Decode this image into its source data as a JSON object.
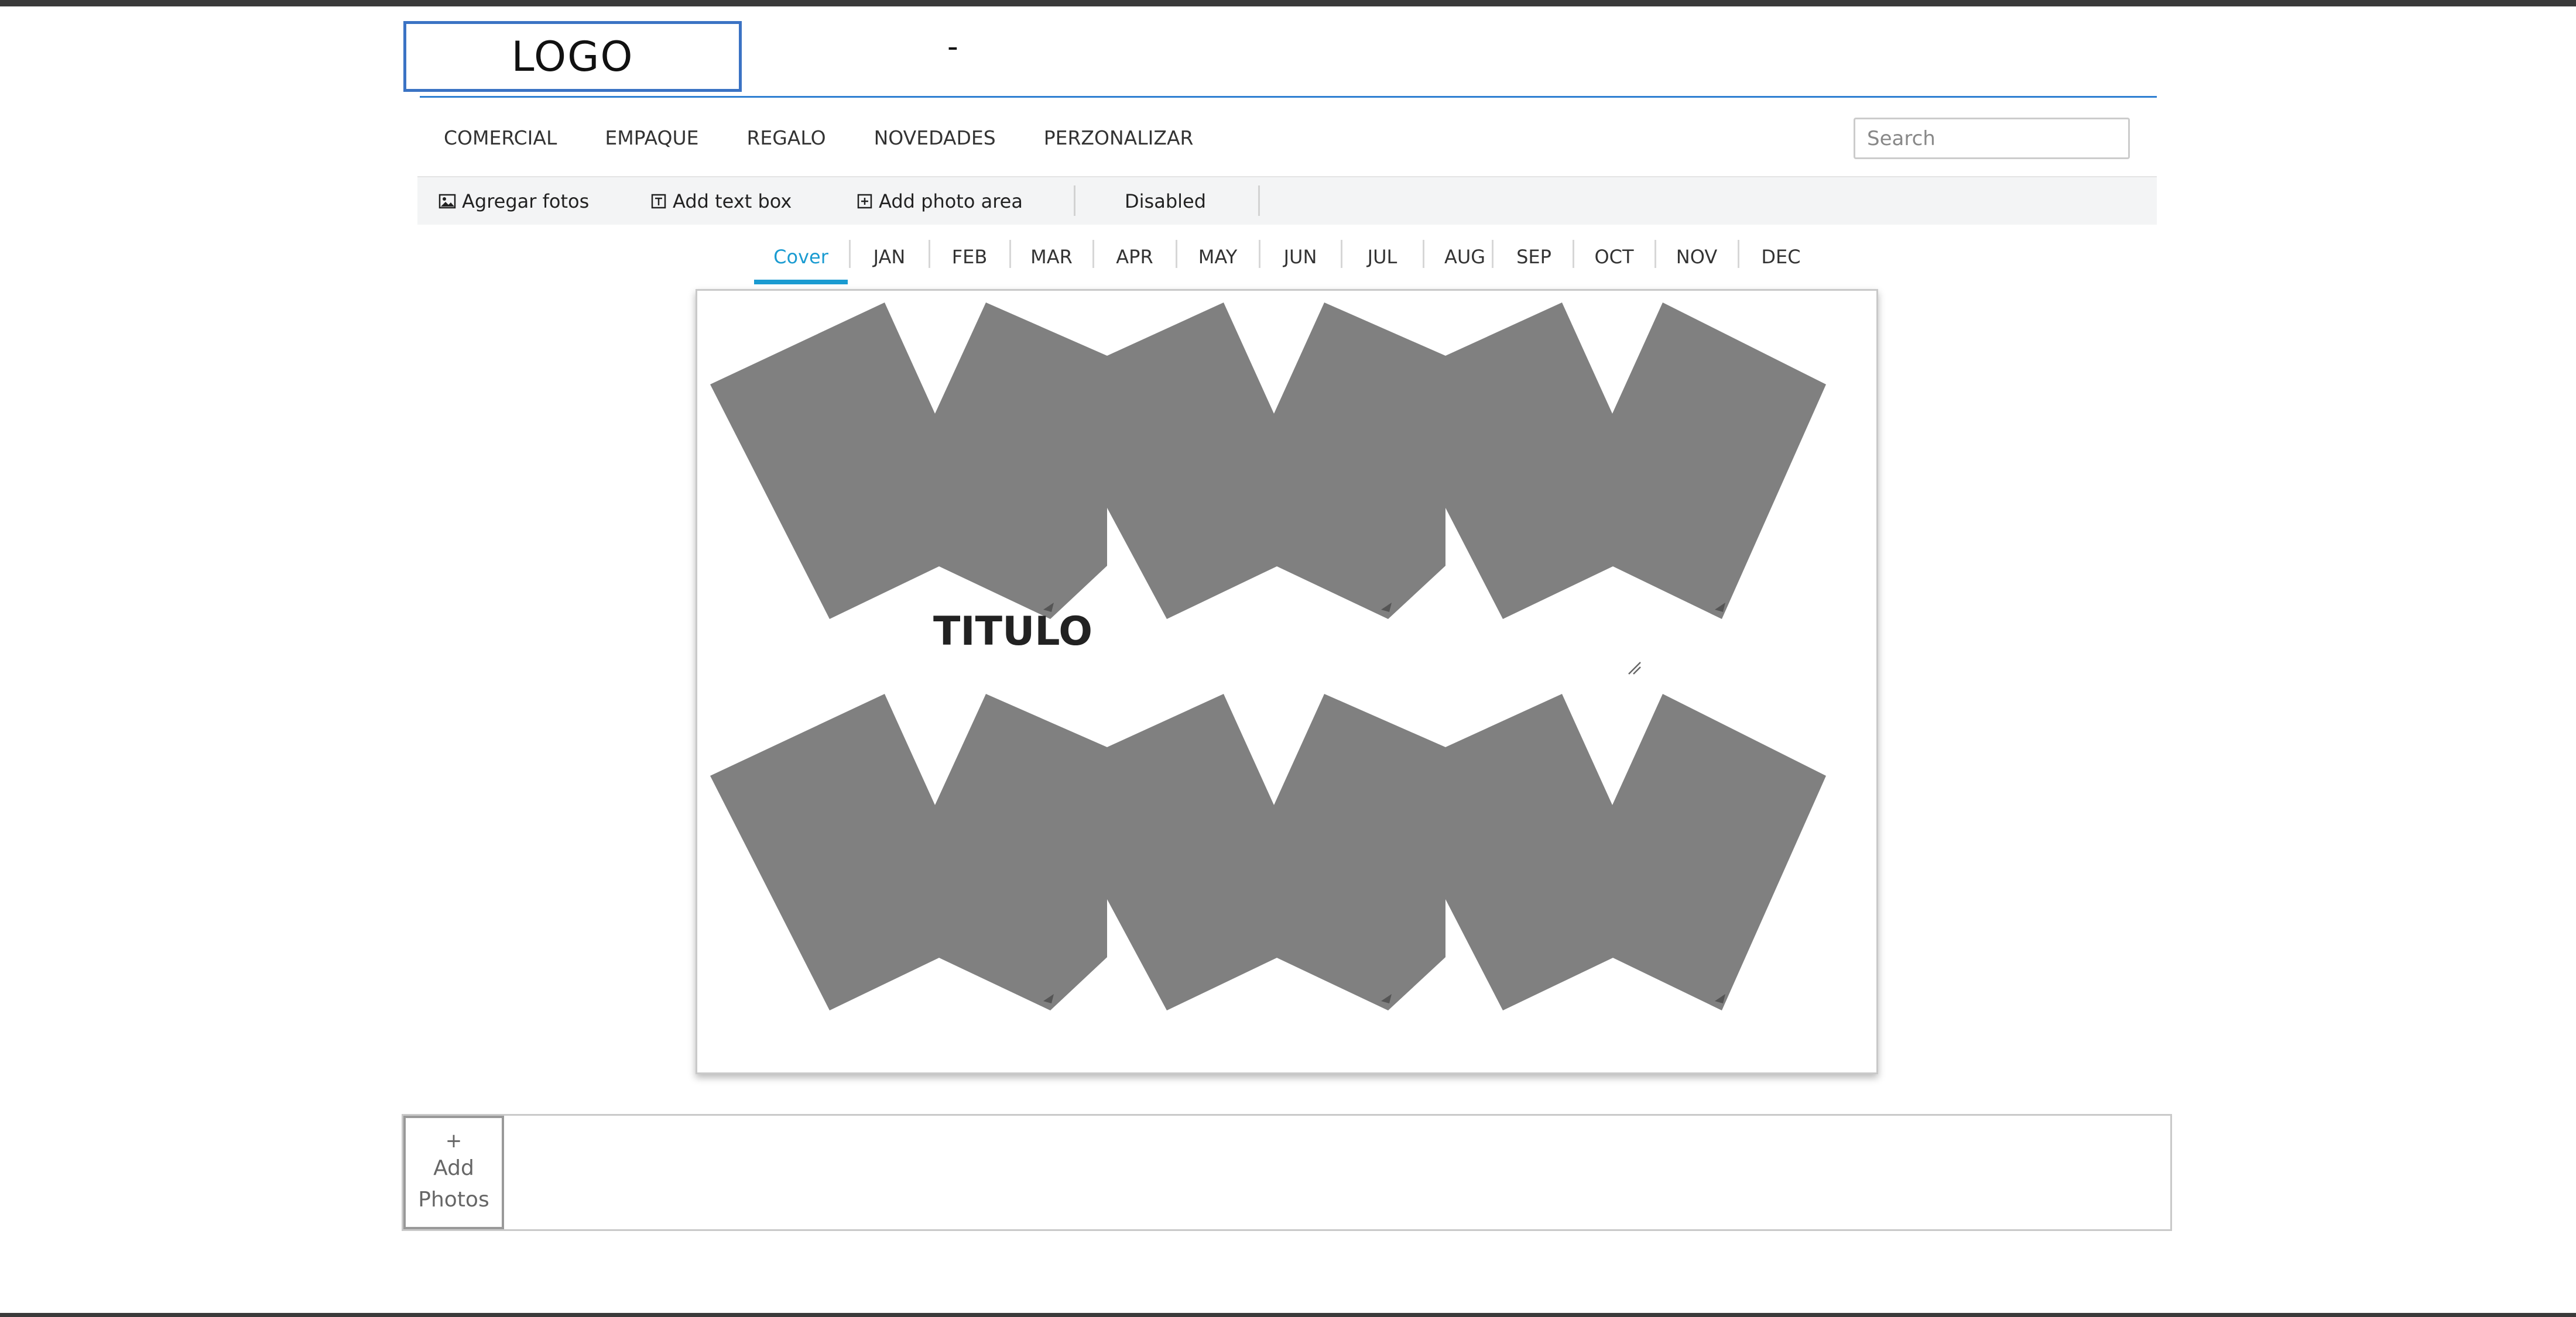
{
  "header": {
    "logo_text": "LOGO",
    "separator_text": "-"
  },
  "nav": {
    "items": [
      {
        "label": "COMERCIAL"
      },
      {
        "label": "EMPAQUE"
      },
      {
        "label": "REGALO"
      },
      {
        "label": "NOVEDADES"
      },
      {
        "label": "PERZONALIZAR"
      }
    ],
    "search_placeholder": "Search"
  },
  "toolbar": {
    "add_photos": "Agregar fotos",
    "add_text_box": "Add text box",
    "add_photo_area": "Add photo area",
    "status": "Disabled"
  },
  "tabs": [
    {
      "label": "Cover",
      "active": true
    },
    {
      "label": "JAN"
    },
    {
      "label": "FEB"
    },
    {
      "label": "MAR"
    },
    {
      "label": "APR"
    },
    {
      "label": "MAY"
    },
    {
      "label": "JUN"
    },
    {
      "label": "JUL"
    },
    {
      "label": "AUG"
    },
    {
      "label": "SEP"
    },
    {
      "label": "OCT"
    },
    {
      "label": "NOV"
    },
    {
      "label": "DEC"
    }
  ],
  "canvas": {
    "title_text": "TITULO",
    "photo_placeholder_color": "#808080"
  },
  "tray": {
    "add_plus": "+",
    "add_line1": "Add",
    "add_line2": "Photos"
  },
  "colors": {
    "accent": "#1a9bd1",
    "header_rule": "#2e7fd1",
    "logo_border": "#3b73c4"
  }
}
